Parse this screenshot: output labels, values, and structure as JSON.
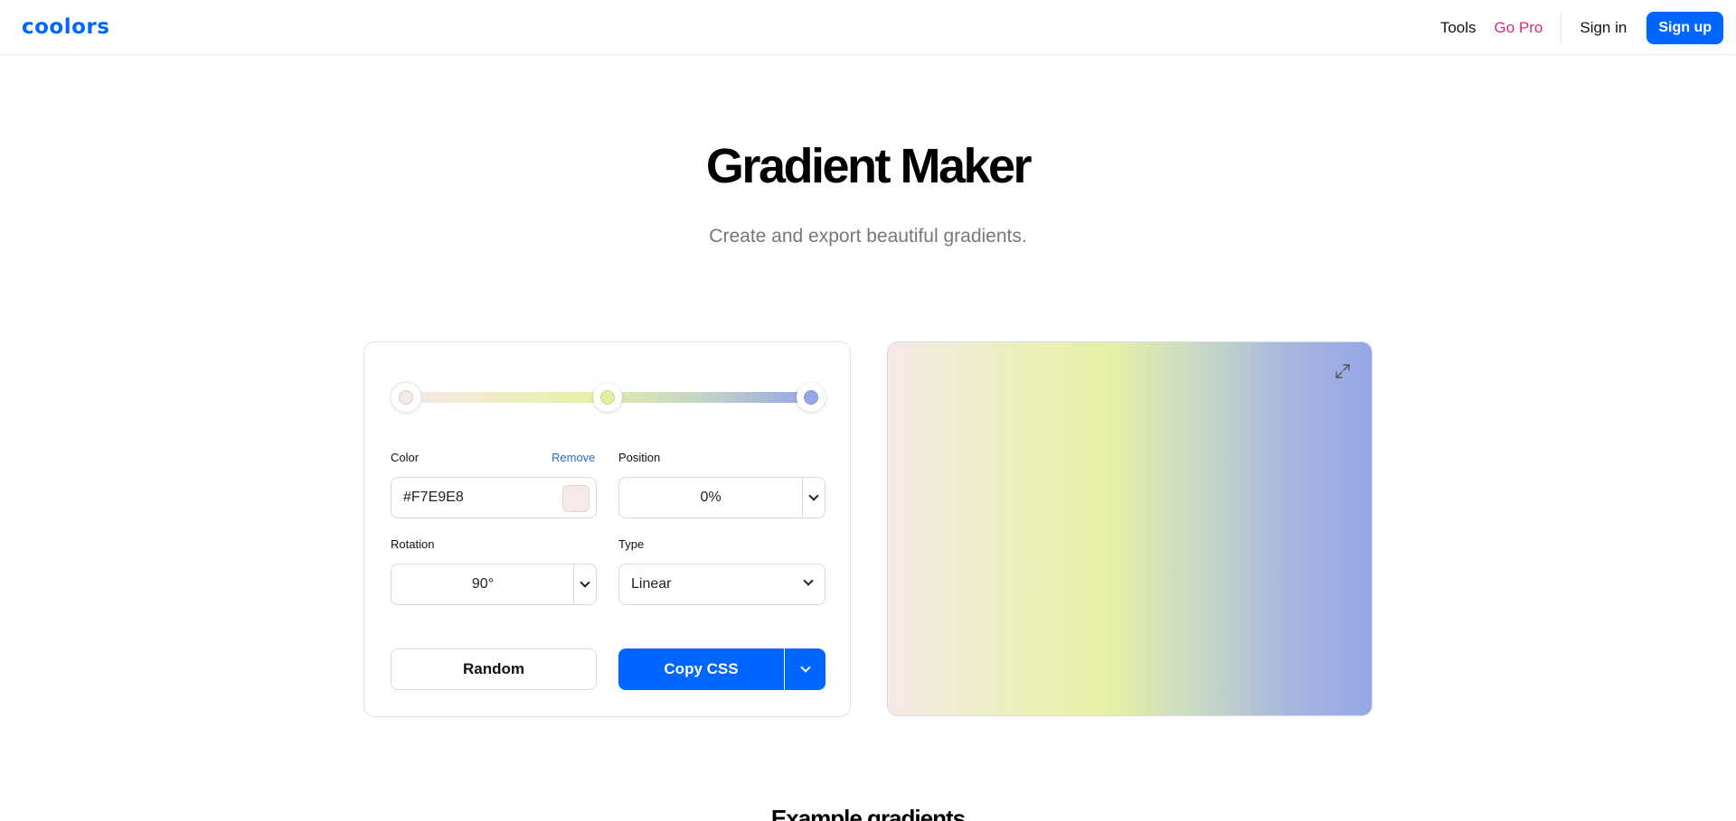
{
  "header": {
    "logo": "coolors",
    "nav": {
      "tools": "Tools",
      "go_pro": "Go Pro",
      "sign_in": "Sign in",
      "sign_up": "Sign up"
    }
  },
  "hero": {
    "title": "Gradient Maker",
    "subtitle": "Create and export beautiful gradients."
  },
  "editor": {
    "stops": [
      {
        "color": "#F7E9E8",
        "position": 0
      },
      {
        "color": "#E6F0A4",
        "position": 50
      },
      {
        "color": "#97A6E8",
        "position": 100
      }
    ],
    "color_label": "Color",
    "remove_label": "Remove",
    "color_value": "#F7E9E8",
    "position_label": "Position",
    "position_value": "0%",
    "rotation_label": "Rotation",
    "rotation_value": "90°",
    "type_label": "Type",
    "type_value": "Linear",
    "random_label": "Random",
    "copy_css_label": "Copy CSS"
  },
  "examples": {
    "title": "Example gradients"
  },
  "colors": {
    "accent": "#0066ff",
    "pro": "#e0267a",
    "link": "#2a6bd6"
  }
}
